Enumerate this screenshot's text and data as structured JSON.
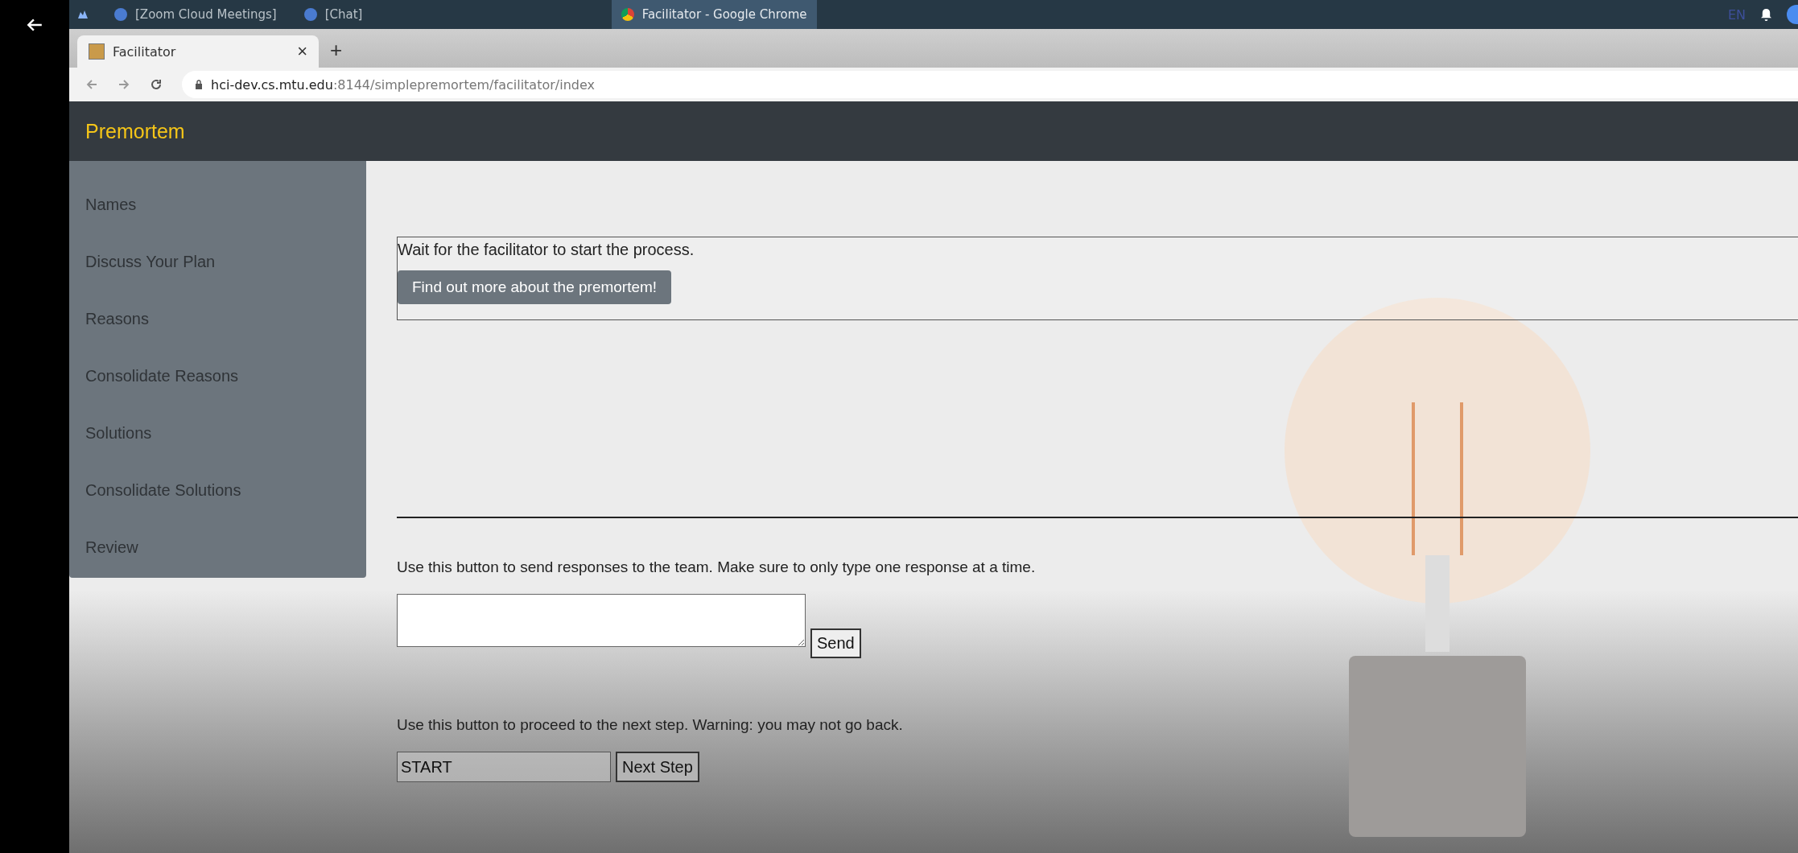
{
  "taskbar": {
    "windows": [
      {
        "title": "[Zoom Cloud Meetings]",
        "selected": false
      },
      {
        "title": "[Chat]",
        "selected": false
      },
      {
        "title": "Facilitator - Google Chrome",
        "selected": true
      }
    ],
    "language": "EN"
  },
  "browser": {
    "tab": {
      "title": "Facilitator",
      "close": "×"
    },
    "new_tab": "+",
    "url_host": "hci-dev.cs.mtu.edu",
    "url_path": ":8144/simplepremortem/facilitator/index"
  },
  "navbar": {
    "brand": "Premortem"
  },
  "sidebar": {
    "items": [
      "Names",
      "Discuss Your Plan",
      "Reasons",
      "Consolidate Reasons",
      "Solutions",
      "Consolidate Solutions",
      "Review"
    ]
  },
  "notice": {
    "text": "Wait for the facilitator to start the process.",
    "button": "Find out more about the premortem!"
  },
  "response": {
    "instruction": "Use this button to send responses to the team. Make sure to only type one response at a time.",
    "button": "Send"
  },
  "next": {
    "instruction": "Use this button to proceed to the next step. Warning: you may not go back.",
    "value": "START",
    "button": "Next Step"
  }
}
